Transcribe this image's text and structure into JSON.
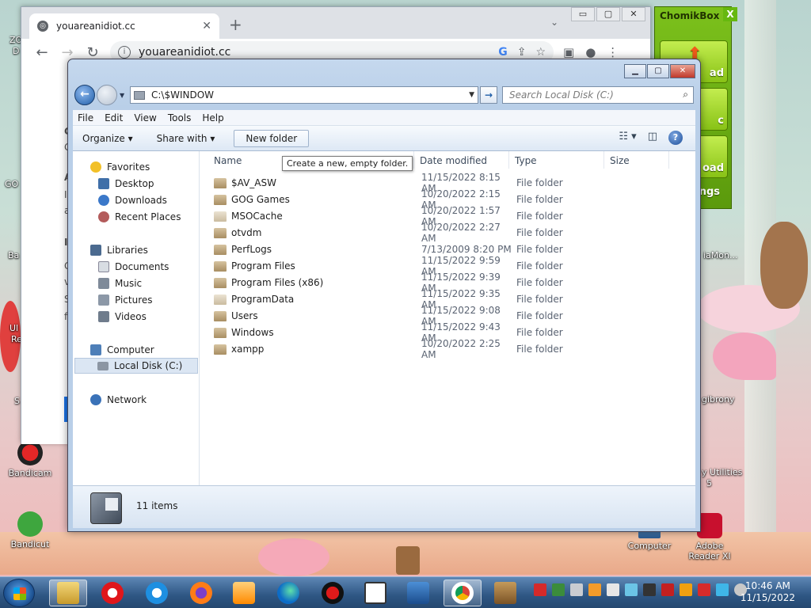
{
  "desktop": {
    "icons": [
      {
        "name": "Bandicam"
      },
      {
        "name": "Bandicut"
      },
      {
        "name": "Computer"
      },
      {
        "name": "Adobe Reader XI"
      }
    ],
    "partial_labels": [
      "ZO",
      "D",
      "GO",
      "Ba",
      "Ul",
      "Re",
      "S",
      "iaMon...",
      "gibrony",
      "y Utilities",
      "5"
    ]
  },
  "chrome": {
    "tab_title": "youareanidiot.cc",
    "url": "youareanidiot.cc",
    "left_fragments": [
      "C",
      "G",
      "A",
      "I",
      "a",
      "I",
      "G",
      "v",
      "S",
      "f"
    ],
    "win_buttons": [
      "▭",
      "▢",
      "✕"
    ]
  },
  "explorer": {
    "address": "C:\\$WINDOW",
    "search_placeholder": "Search Local Disk (C:)",
    "menu": [
      "File",
      "Edit",
      "View",
      "Tools",
      "Help"
    ],
    "commands": {
      "organize": "Organize",
      "share": "Share with",
      "new_folder": "New folder"
    },
    "tooltip": "Create a new, empty folder.",
    "columns": {
      "name": "Name",
      "date": "Date modified",
      "type": "Type",
      "size": "Size"
    },
    "nav": {
      "favorites": "Favorites",
      "desktop": "Desktop",
      "downloads": "Downloads",
      "recent": "Recent Places",
      "libraries": "Libraries",
      "documents": "Documents",
      "music": "Music",
      "pictures": "Pictures",
      "videos": "Videos",
      "computer": "Computer",
      "local_disk": "Local Disk (C:)",
      "network": "Network"
    },
    "files": [
      {
        "name": "$AV_ASW",
        "date": "11/15/2022 8:15 AM",
        "type": "File folder"
      },
      {
        "name": "GOG Games",
        "date": "10/20/2022 2:15 AM",
        "type": "File folder"
      },
      {
        "name": "MSOCache",
        "date": "10/20/2022 1:57 AM",
        "type": "File folder"
      },
      {
        "name": "otvdm",
        "date": "10/20/2022 2:27 AM",
        "type": "File folder"
      },
      {
        "name": "PerfLogs",
        "date": "7/13/2009 8:20 PM",
        "type": "File folder"
      },
      {
        "name": "Program Files",
        "date": "11/15/2022 9:59 AM",
        "type": "File folder"
      },
      {
        "name": "Program Files (x86)",
        "date": "11/15/2022 9:39 AM",
        "type": "File folder"
      },
      {
        "name": "ProgramData",
        "date": "11/15/2022 9:35 AM",
        "type": "File folder"
      },
      {
        "name": "Users",
        "date": "11/15/2022 9:08 AM",
        "type": "File folder"
      },
      {
        "name": "Windows",
        "date": "11/15/2022 9:43 AM",
        "type": "File folder"
      },
      {
        "name": "xampp",
        "date": "10/20/2022 2:25 AM",
        "type": "File folder"
      }
    ],
    "item_count": "11 items"
  },
  "chomikbox": {
    "title": "ChomikBox",
    "close": "X",
    "buttons": [
      "ad",
      "c",
      "oad"
    ],
    "extra": "ngs"
  },
  "taskbar": {
    "time": "10:46 AM",
    "date": "11/15/2022"
  }
}
